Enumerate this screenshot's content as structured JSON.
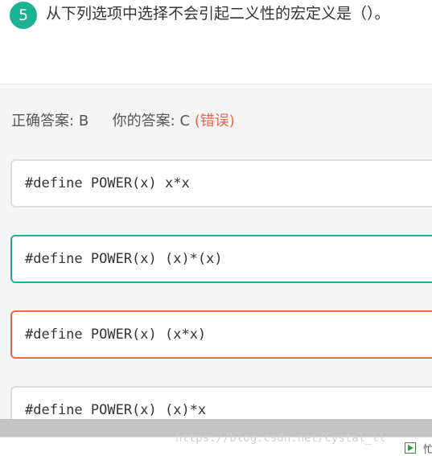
{
  "question": {
    "number": "5",
    "text": "从下列选项中选择不会引起二义性的宏定义是（）。"
  },
  "answer": {
    "correct_label": "正确答案:",
    "correct_value": "B",
    "yours_label": "你的答案:",
    "yours_value": "C",
    "result": "(错误)"
  },
  "options": [
    {
      "code": "#define POWER(x) x*x",
      "state": "normal"
    },
    {
      "code": "#define POWER(x) (x)*(x)",
      "state": "correct"
    },
    {
      "code": "#define POWER(x) (x*x)",
      "state": "wrong"
    },
    {
      "code": "#define POWER(x) (x)*x",
      "state": "normal"
    }
  ],
  "watermark": "https://blog.csdn.net/Cystal_ll",
  "taskbar": {
    "edge_text": "忙"
  },
  "colors": {
    "accent": "#1bb394",
    "error": "#e8674c",
    "panel_bg": "#f5f5f5",
    "option_border": "#dcdcdc"
  },
  "icons": [
    "play-icon"
  ]
}
